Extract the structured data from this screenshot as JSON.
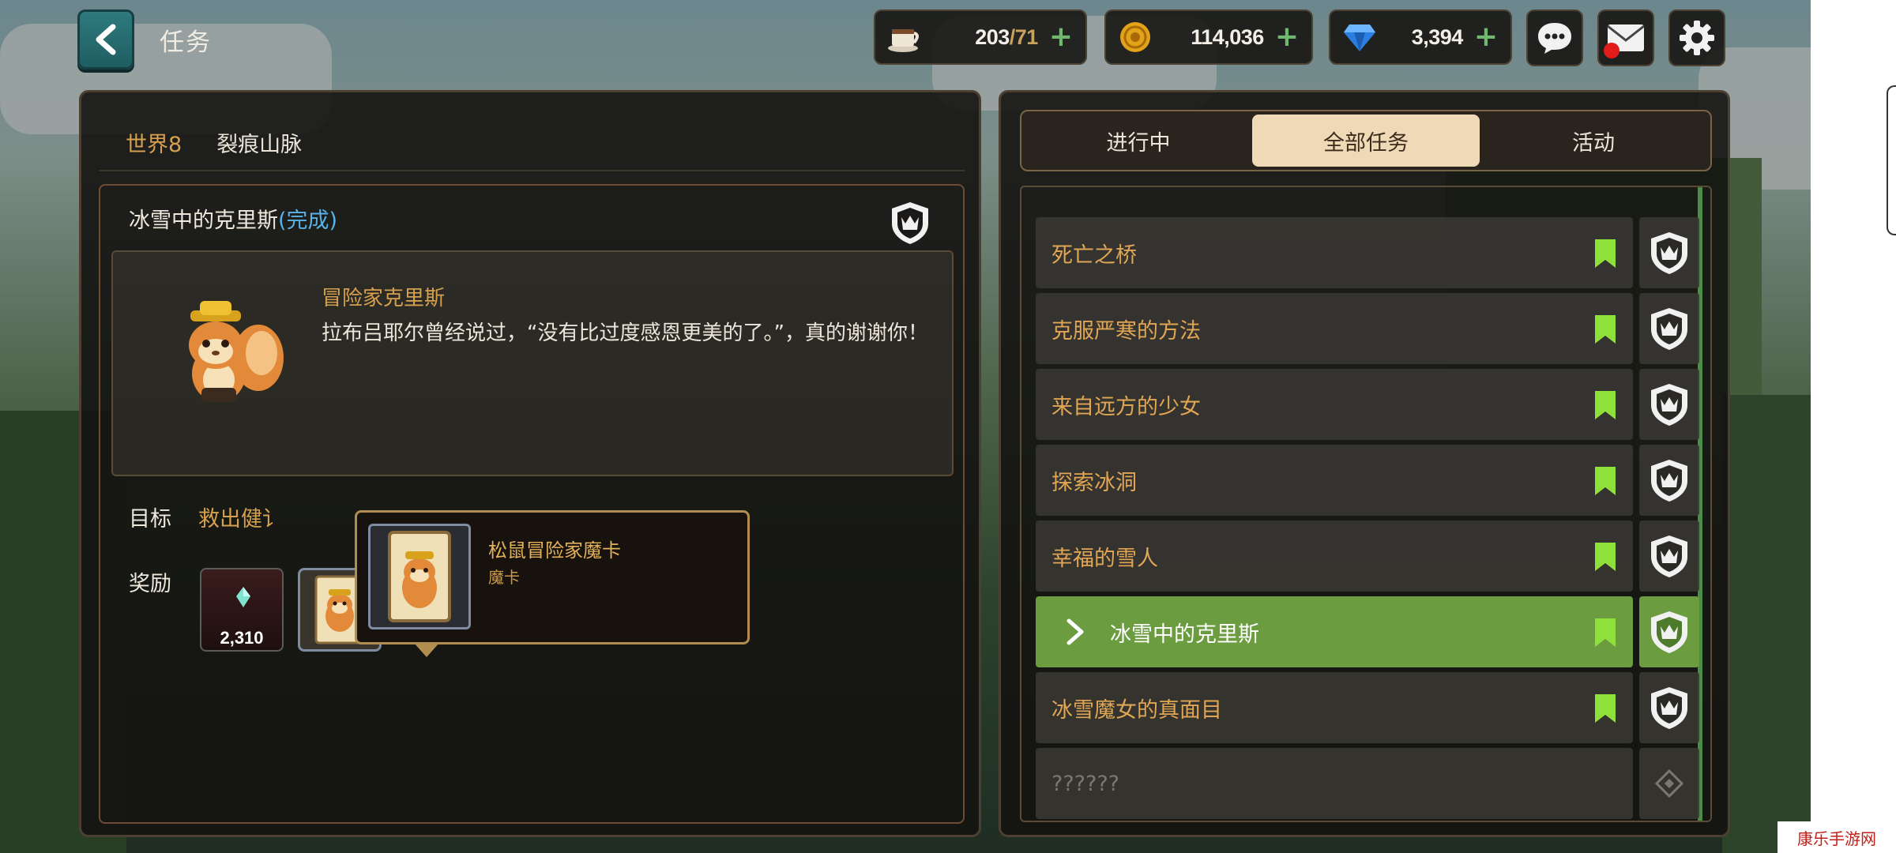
{
  "header": {
    "title": "任务",
    "resources": {
      "stamina": {
        "value": "203",
        "cap": "/71"
      },
      "gold": {
        "value": "114,036"
      },
      "gems": {
        "value": "3,394"
      }
    }
  },
  "quest_detail": {
    "world": "世界8",
    "location": "裂痕山脉",
    "title": "冰雪中的克里斯",
    "status": "(完成)",
    "npc_name": "冒险家克里斯",
    "npc_dialog": "拉布吕耶尔曾经说过，“没有比过度感恩更美的了。”，真的谢谢你！",
    "goal_label": "目标",
    "goal_text": "救出健讠",
    "reward_label": "奖励",
    "rewards": [
      {
        "type": "gem",
        "qty": "2,310"
      },
      {
        "type": "card"
      }
    ],
    "tooltip": {
      "name": "松鼠冒险家魔卡",
      "type": "魔卡"
    }
  },
  "tabs": [
    {
      "label": "进行中",
      "active": false
    },
    {
      "label": "全部任务",
      "active": true
    },
    {
      "label": "活动",
      "active": false
    }
  ],
  "quest_list": [
    {
      "name": "死亡之桥",
      "state": "complete"
    },
    {
      "name": "克服严寒的方法",
      "state": "complete"
    },
    {
      "name": "来自远方的少女",
      "state": "complete"
    },
    {
      "name": "探索冰洞",
      "state": "complete"
    },
    {
      "name": "幸福的雪人",
      "state": "complete"
    },
    {
      "name": "冰雪中的克里斯",
      "state": "selected"
    },
    {
      "name": "冰雪魔女的真面目",
      "state": "complete"
    },
    {
      "name": "??????",
      "state": "locked"
    }
  ],
  "colors": {
    "accent_gold": "#d6a04f",
    "done_blue": "#59b2e6",
    "selected_green": "#6b9c3f",
    "bookmark_green": "#8ee03a"
  },
  "watermark": "康乐手游网"
}
